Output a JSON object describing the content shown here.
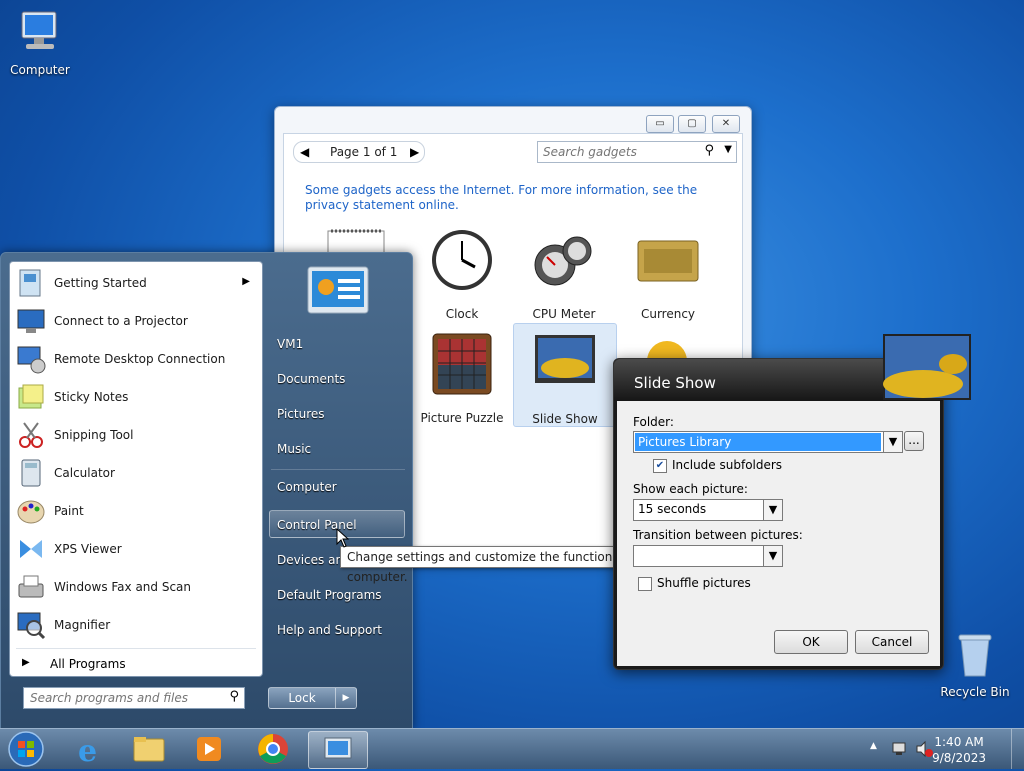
{
  "desktop": {
    "computer_label": "Computer",
    "recycle_label": "Recycle Bin"
  },
  "gadgets_window": {
    "page_label": "Page 1 of 1",
    "search_placeholder": "Search gadgets",
    "info_text": "Some gadgets access the Internet.  For more information, see the privacy statement online.",
    "tiles": [
      {
        "label": "Clock"
      },
      {
        "label": "CPU Meter"
      },
      {
        "label": "Currency"
      },
      {
        "label": "Picture Puzzle"
      },
      {
        "label": "Slide Show"
      }
    ]
  },
  "start_menu": {
    "programs": [
      {
        "label": "Getting Started"
      },
      {
        "label": "Connect to a Projector"
      },
      {
        "label": "Remote Desktop Connection"
      },
      {
        "label": "Sticky Notes"
      },
      {
        "label": "Snipping Tool"
      },
      {
        "label": "Calculator"
      },
      {
        "label": "Paint"
      },
      {
        "label": "XPS Viewer"
      },
      {
        "label": "Windows Fax and Scan"
      },
      {
        "label": "Magnifier"
      }
    ],
    "all_programs": "All Programs",
    "search_placeholder": "Search programs and files",
    "right_links": [
      {
        "label": "VM1"
      },
      {
        "label": "Documents"
      },
      {
        "label": "Pictures"
      },
      {
        "label": "Music"
      },
      {
        "label": "Computer"
      },
      {
        "label": "Control Panel"
      },
      {
        "label": "Devices and"
      },
      {
        "label": "Default Programs"
      },
      {
        "label": "Help and Support"
      }
    ],
    "lock_label": "Lock",
    "tooltip": "Change settings and customize the functionality of your computer."
  },
  "slideshow_dialog": {
    "title": "Slide Show",
    "folder_label": "Folder:",
    "folder_value": "Pictures Library",
    "browse_label": "...",
    "include_subfolders_label": "Include subfolders",
    "include_subfolders_checked": true,
    "show_each_label": "Show each picture:",
    "show_each_value": "15 seconds",
    "transition_label": "Transition between pictures:",
    "transition_value": "",
    "shuffle_label": "Shuffle pictures",
    "shuffle_checked": false,
    "ok_label": "OK",
    "cancel_label": "Cancel"
  },
  "taskbar": {
    "time": "1:40 AM",
    "date": "9/8/2023"
  },
  "colors": {
    "link_blue": "#1e64c8",
    "selection_blue": "#3399ff"
  }
}
